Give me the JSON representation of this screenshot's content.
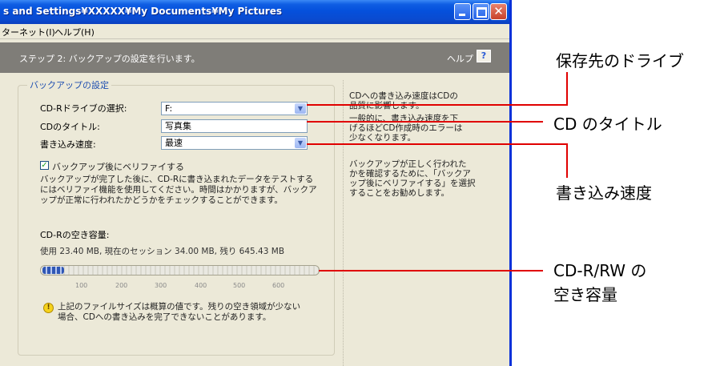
{
  "window": {
    "title": "s and Settings¥XXXXX¥My Documents¥My Pictures",
    "close_glyph": "✕"
  },
  "menu": {
    "item1": "ターネット(I)",
    "item2": "ヘルプ(H)"
  },
  "step": {
    "text": "ステップ 2: バックアップの設定を行います。",
    "help_label": "ヘルプ",
    "help_icon": "?"
  },
  "settings": {
    "group_title": "バックアップの設定",
    "drive_label": "CD-Rドライブの選択:",
    "drive_value": "F:",
    "title_label": "CDのタイトル:",
    "title_value": "写真集",
    "speed_label": "書き込み速度:",
    "speed_value": "最速",
    "verify_label": "バックアップ後にベリファイする",
    "verify_checked": true,
    "verify_desc": [
      "バックアップが完了した後に、CD-Rに書き込まれたデータをテストする",
      "にはベリファイ機能を使用してください。時間はかかりますが、バックア",
      "ップが正常に行われたかどうかをチェックすることができます。"
    ],
    "free_space_label": "CD-Rの空き容量:",
    "usage_text": "使用 23.40 MB, 現在のセッション 34.00 MB, 残り 645.43 MB",
    "usage_fraction": 0.08,
    "ticks": [
      "100",
      "200",
      "300",
      "400",
      "500",
      "600"
    ],
    "warning": [
      "上記のファイルサイズは概算の値です。残りの空き領域が少ない",
      "場合、CDへの書き込みを完了できないことがあります。"
    ]
  },
  "sidebar": {
    "para1": [
      "CDへの書き込み速度はCDの",
      "品質に影響します。"
    ],
    "para2": [
      "一般的に、書き込み速度を下",
      "げるほどCD作成時のエラーは",
      "少なくなります。"
    ],
    "para3": [
      "バックアップが正しく行われた",
      "かを確認するために、「バックア",
      "ップ後にベリファイする」を選択",
      "することをお勧めします。"
    ]
  },
  "callouts": {
    "drive": "保存先のドライブ",
    "title": "CD のタイトル",
    "speed": "書き込み速度",
    "space_line1": "CD-R/RW の",
    "space_line2": "空き容量",
    "line_color": "#e00000"
  }
}
